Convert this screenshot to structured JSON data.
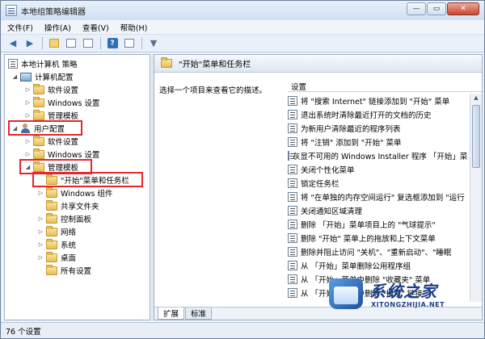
{
  "window": {
    "title": "本地组策略编辑器",
    "minimize": "—",
    "maximize": "▭",
    "close": "✕"
  },
  "menu": [
    "文件(F)",
    "操作(A)",
    "查看(V)",
    "帮助(H)"
  ],
  "tree": {
    "root": "本地计算机 策略",
    "computer_config": "计算机配置",
    "software_settings_1": "软件设置",
    "windows_settings_1": "Windows 设置",
    "admin_templates_1": "管理模板",
    "user_config": "用户配置",
    "software_settings_2": "软件设置",
    "windows_settings_2": "Windows 设置",
    "admin_templates_2": "管理模板",
    "start_menu_taskbar": "\"开始\"菜单和任务栏",
    "windows_components": "Windows 组件",
    "shared_folders": "共享文件夹",
    "control_panel": "控制面板",
    "network": "网络",
    "system": "系统",
    "desktop": "桌面",
    "all_settings": "所有设置"
  },
  "right": {
    "header": "\"开始\"菜单和任务栏",
    "description": "选择一个项目来查看它的描述。",
    "settings_header": "设置",
    "settings": [
      "将 \"搜索 Internet\" 链接添加到 \"开始\" 菜单",
      "退出系统时清除最近打开的文档的历史",
      "为新用户清除最近的程序列表",
      "将 \"注销\" 添加到 \"开始\" 菜单",
      "灰显不可用的 Windows Installer 程序 「开始」菜单",
      "关闭个性化菜单",
      "锁定任务栏",
      "将 \"在单独的内存空间运行\" 复选框添加到 \"运行",
      "关闭通知区域清理",
      "删除 「开始」菜单项目上的 \"气球提示\"",
      "删除 \"开始\" 菜单上的拖放和上下文菜单",
      "删除并阻止访问 \"关机\"、\"重新启动\"、\"睡眠",
      "从 「开始」菜单删除公用程序组",
      "从 「开始」菜单中删除 \"收藏夹\" 菜单",
      "从 「开始」菜单中删除 \"搜索\" 链接"
    ],
    "tabs": [
      "扩展",
      "标准"
    ]
  },
  "status": "76 个设置",
  "watermark": {
    "main": "系统之家",
    "sub": "XITONGZHIJIA.NET"
  }
}
